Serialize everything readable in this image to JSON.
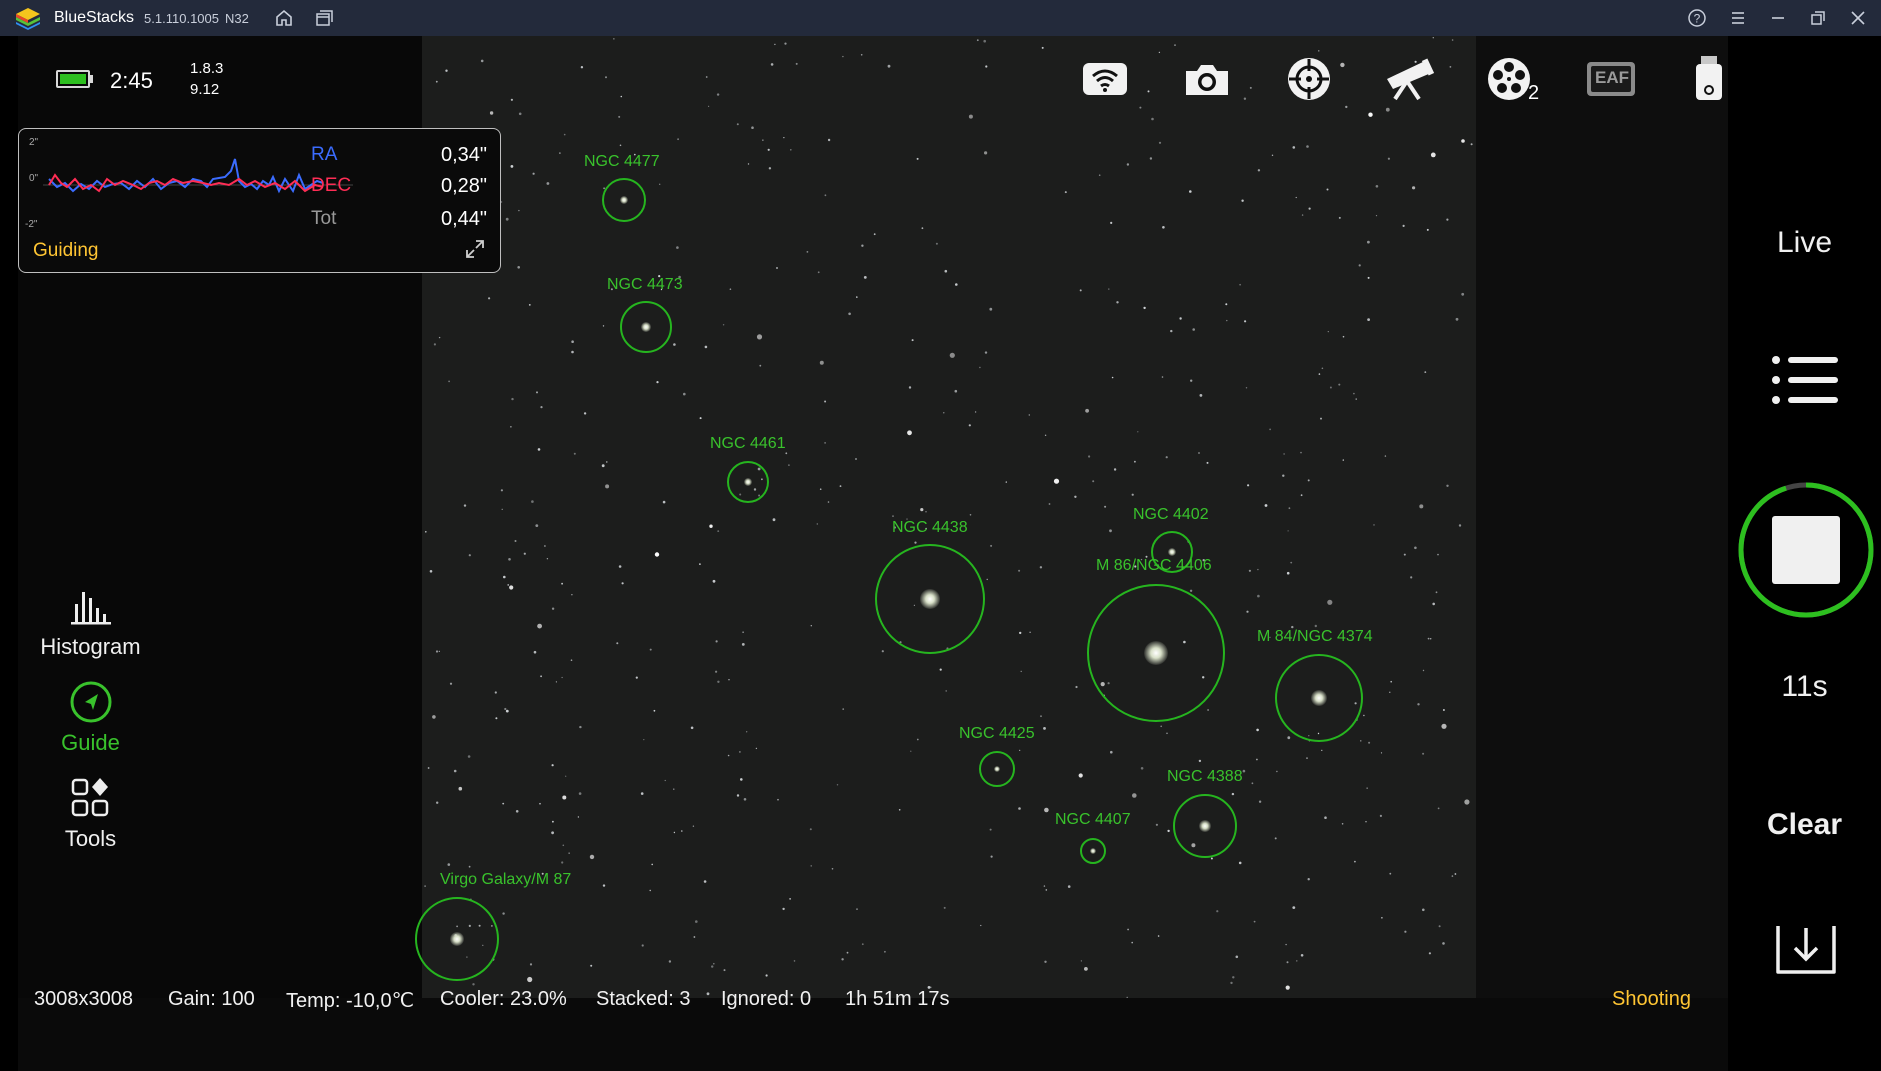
{
  "window": {
    "title": "BlueStacks",
    "version": "5.1.110.1005",
    "build": "N32"
  },
  "header": {
    "clock": "2:45",
    "version_a": "1.8.3",
    "version_b": "9.12",
    "battery_level": 0.9
  },
  "guide_panel": {
    "axis_top": "2\"",
    "axis_mid": "0\"",
    "axis_bottom": "-2\"",
    "ra_label": "RA",
    "ra_value": "0,34\"",
    "dec_label": "DEC",
    "dec_value": "0,28\"",
    "tot_label": "Tot",
    "tot_value": "0,44\"",
    "status": "Guiding"
  },
  "left_tools": [
    {
      "label": "Histogram"
    },
    {
      "label": "Guide"
    },
    {
      "label": "Tools"
    }
  ],
  "top_icons": [
    "wifi-icon",
    "camera-icon",
    "focus-target-icon",
    "telescope-icon",
    "filter-wheel-icon",
    "eaf-icon",
    "usb-drive-icon",
    "info-icon"
  ],
  "filter_wheel_badge": "2",
  "eaf_label": "EAF",
  "objects": [
    {
      "label": "NGC 4477"
    },
    {
      "label": "NGC 4473"
    },
    {
      "label": "NGC 4461"
    },
    {
      "label": "NGC 4438"
    },
    {
      "label": "NGC 4402"
    },
    {
      "label": "M 86/NGC 4406"
    },
    {
      "label": "M 84/NGC 4374"
    },
    {
      "label": "NGC 4425"
    },
    {
      "label": "NGC 4388"
    },
    {
      "label": "NGC 4407"
    },
    {
      "label": "Virgo Galaxy/M 87"
    }
  ],
  "right_panel": {
    "live": "Live",
    "countdown": "11s",
    "clear": "Clear",
    "progress": 0.95
  },
  "status": {
    "resolution": "3008x3008",
    "gain": "Gain: 100",
    "temp": "Temp: -10,0℃",
    "cooler": "Cooler: 23.0%",
    "stacked": "Stacked: 3",
    "ignored": "Ignored: 0",
    "elapsed": "1h 51m 17s",
    "state": "Shooting"
  },
  "colors": {
    "accent_green": "#39c22c",
    "ra_blue": "#3b6cff",
    "dec_red": "#ff2d55",
    "guiding_yellow": "#ffc533",
    "shooting_yellow": "#ffc533"
  }
}
